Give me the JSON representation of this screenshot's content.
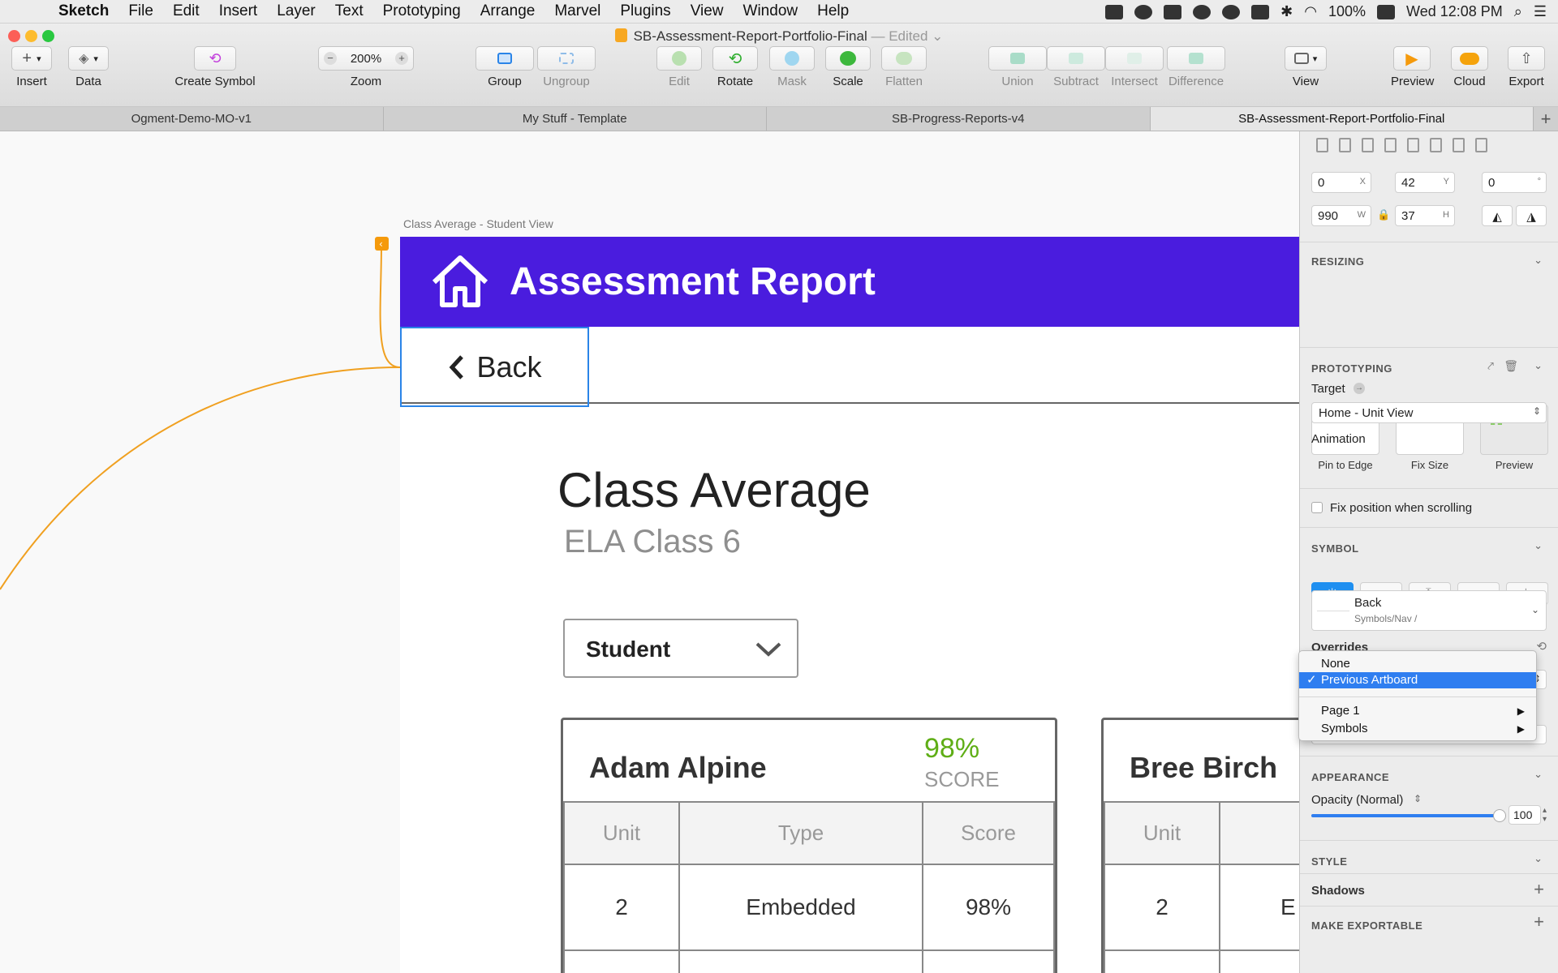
{
  "menubar": {
    "app": "Sketch",
    "items": [
      "File",
      "Edit",
      "Insert",
      "Layer",
      "Text",
      "Prototyping",
      "Arrange",
      "Marvel",
      "Plugins",
      "View",
      "Window",
      "Help"
    ],
    "battery": "100%",
    "clock": "Wed 12:08 PM"
  },
  "window": {
    "doc_title": "SB-Assessment-Report-Portfolio-Final",
    "edited": "— Edited"
  },
  "toolbar": {
    "insert": "Insert",
    "data": "Data",
    "create_symbol": "Create Symbol",
    "zoom_value": "200%",
    "zoom": "Zoom",
    "group": "Group",
    "ungroup": "Ungroup",
    "edit": "Edit",
    "rotate": "Rotate",
    "mask": "Mask",
    "scale": "Scale",
    "flatten": "Flatten",
    "union": "Union",
    "subtract": "Subtract",
    "intersect": "Intersect",
    "difference": "Difference",
    "view": "View",
    "preview": "Preview",
    "cloud": "Cloud",
    "export": "Export"
  },
  "tabs": [
    "Ogment-Demo-MO-v1",
    "My Stuff - Template",
    "SB-Progress-Reports-v4",
    "SB-Assessment-Report-Portfolio-Final"
  ],
  "artboard": {
    "label": "Class Average - Student View",
    "header_title": "Assessment Report",
    "back": "Back",
    "title": "Class Average",
    "subtitle": "ELA Class 6",
    "dropdown": "Student",
    "cards": [
      {
        "name": "Adam Alpine",
        "score": "98%",
        "score_label": "SCORE",
        "columns": [
          "Unit",
          "Type",
          "Score"
        ],
        "rows": [
          [
            "2",
            "Embedded",
            "98%"
          ]
        ]
      },
      {
        "name": "Bree Birch",
        "columns": [
          "Unit"
        ],
        "rows": [
          [
            "2",
            "E"
          ]
        ]
      }
    ]
  },
  "inspector": {
    "x": "0",
    "x_suffix": "X",
    "y": "42",
    "y_suffix": "Y",
    "rotation": "0",
    "rotation_suffix": "°",
    "w": "990",
    "w_suffix": "W",
    "h": "37",
    "h_suffix": "H",
    "resizing": "RESIZING",
    "pin_to_edge": "Pin to Edge",
    "fix_size": "Fix Size",
    "preview": "Preview",
    "prototyping": "PROTOTYPING",
    "target_label": "Target",
    "target_value": "Home - Unit View",
    "animation_label": "Animation",
    "fix_position": "Fix position when scrolling",
    "symbol": "SYMBOL",
    "symbol_name": "Back",
    "symbol_path": "Symbols/Nav /",
    "overrides": "Overrides",
    "appearance": "APPEARANCE",
    "opacity_label": "Opacity (Normal)",
    "opacity_value": "100",
    "opacity_fraction": 1.0,
    "style": "STYLE",
    "shadows": "Shadows",
    "make_exportable": "MAKE EXPORTABLE"
  },
  "popup": {
    "items": [
      "None",
      "Previous Artboard",
      "Page 1",
      "Symbols"
    ],
    "selected": "Previous Artboard"
  },
  "colors": {
    "header": "#4a1cde",
    "selection": "#2a84e8",
    "score": "#5fae16",
    "link": "#f0a020",
    "menu_highlight": "#2f7ef0"
  }
}
